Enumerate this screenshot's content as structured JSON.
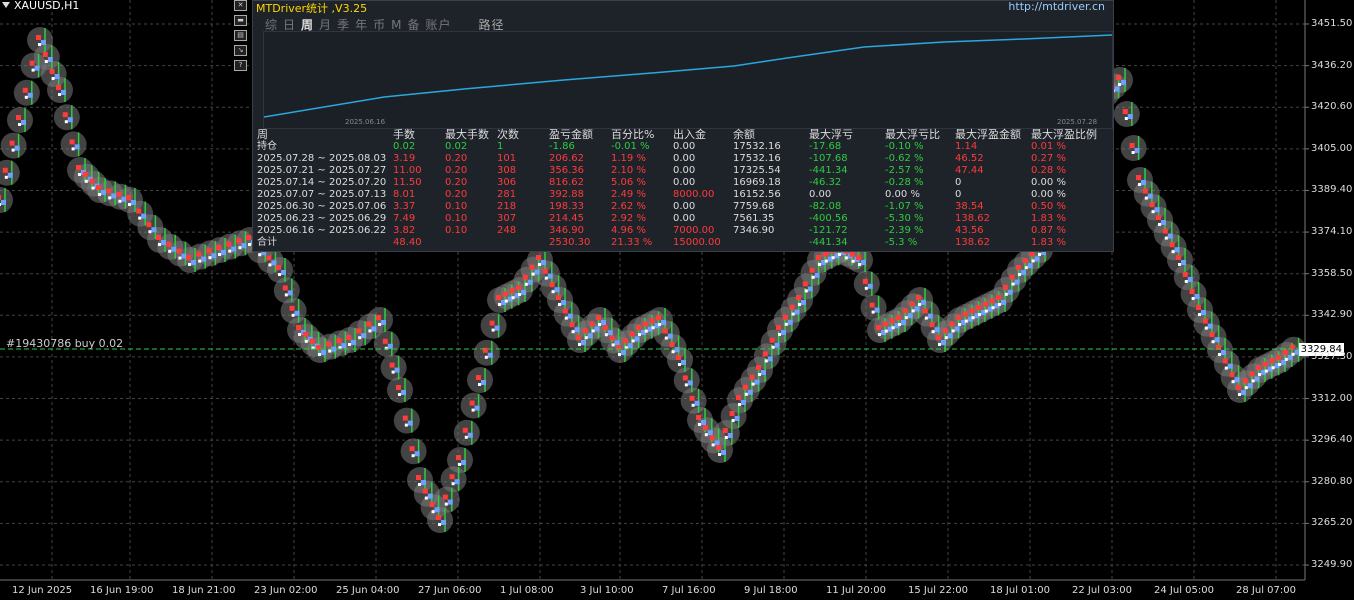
{
  "chart_header": {
    "symbol": "XAUUSD,H1"
  },
  "order_line": {
    "label": "#19430786 buy 0.02",
    "price": "3329.84"
  },
  "price_axis": [
    "3451.50",
    "3436.20",
    "3420.60",
    "3405.00",
    "3389.40",
    "3374.10",
    "3358.50",
    "3342.90",
    "3327.30",
    "3312.00",
    "3296.40",
    "3280.80",
    "3265.20",
    "3249.90"
  ],
  "time_axis": [
    "12 Jun 2025",
    "16 Jun 19:00",
    "18 Jun 21:00",
    "23 Jun 02:00",
    "25 Jun 04:00",
    "27 Jun 06:00",
    "1 Jul 08:00",
    "3 Jul 10:00",
    "7 Jul 16:00",
    "9 Jul 18:00",
    "11 Jul 20:00",
    "15 Jul 22:00",
    "18 Jul 01:00",
    "22 Jul 03:00",
    "24 Jul 05:00",
    "28 Jul 07:00"
  ],
  "side_icons": [
    "close-icon",
    "minimize-icon",
    "chart-icon",
    "arrow-icon",
    "help-icon"
  ],
  "colors": {
    "equity_line": "#2aa7e0",
    "profit": "#2ecc40",
    "loss": "#ff3b3b",
    "candle_up": "#2ecc40",
    "background": "#000000"
  },
  "panel": {
    "title": "MTDriver统计 ,V3.25",
    "link": "http://mtdriver.cn",
    "tabs": [
      "综",
      "日",
      "周",
      "月",
      "季",
      "年",
      "币",
      "M",
      "备",
      "账户"
    ],
    "active_tab": "周",
    "path_tab": "路径",
    "date_start": "2025.06.16",
    "date_end": "2025.07.28",
    "headers": [
      "周",
      "手数",
      "最大手数",
      "次数",
      "盈亏金额",
      "百分比%",
      "出入金",
      "余额",
      "最大浮亏",
      "最大浮亏比",
      "最大浮盈金额",
      "最大浮盈比例"
    ],
    "rows": [
      {
        "c": [
          "持仓",
          "0.02",
          "0.02",
          "1",
          "-1.86",
          "-0.01 %",
          "0.00",
          "17532.16",
          "-17.68",
          "-0.10 %",
          "1.14",
          "0.01 %"
        ],
        "k": [
          "w",
          "g",
          "g",
          "g",
          "g",
          "g",
          "w",
          "w",
          "g",
          "g",
          "r",
          "r"
        ]
      },
      {
        "c": [
          "2025.07.28 ~ 2025.08.03",
          "3.19",
          "0.20",
          "101",
          "206.62",
          "1.19 %",
          "0.00",
          "17532.16",
          "-107.68",
          "-0.62 %",
          "46.52",
          "0.27 %"
        ],
        "k": [
          "w",
          "r",
          "r",
          "r",
          "r",
          "r",
          "w",
          "w",
          "g",
          "g",
          "r",
          "r"
        ]
      },
      {
        "c": [
          "2025.07.21 ~ 2025.07.27",
          "11.00",
          "0.20",
          "308",
          "356.36",
          "2.10 %",
          "0.00",
          "17325.54",
          "-441.34",
          "-2.57 %",
          "47.44",
          "0.28 %"
        ],
        "k": [
          "w",
          "r",
          "r",
          "r",
          "r",
          "r",
          "w",
          "w",
          "g",
          "g",
          "r",
          "r"
        ]
      },
      {
        "c": [
          "2025.07.14 ~ 2025.07.20",
          "11.50",
          "0.20",
          "306",
          "816.62",
          "5.06 %",
          "0.00",
          "16969.18",
          "-46.32",
          "-0.28 %",
          "0",
          "0.00 %"
        ],
        "k": [
          "w",
          "r",
          "r",
          "r",
          "r",
          "r",
          "w",
          "w",
          "g",
          "g",
          "w",
          "w"
        ]
      },
      {
        "c": [
          "2025.07.07 ~ 2025.07.13",
          "8.01",
          "0.20",
          "281",
          "392.88",
          "2.49 %",
          "8000.00",
          "16152.56",
          "0.00",
          "0.00 %",
          "0",
          "0.00 %"
        ],
        "k": [
          "w",
          "r",
          "r",
          "r",
          "r",
          "r",
          "r",
          "w",
          "w",
          "w",
          "w",
          "w"
        ]
      },
      {
        "c": [
          "2025.06.30 ~ 2025.07.06",
          "3.37",
          "0.10",
          "218",
          "198.33",
          "2.62 %",
          "0.00",
          "7759.68",
          "-82.08",
          "-1.07 %",
          "38.54",
          "0.50 %"
        ],
        "k": [
          "w",
          "r",
          "r",
          "r",
          "r",
          "r",
          "w",
          "w",
          "g",
          "g",
          "r",
          "r"
        ]
      },
      {
        "c": [
          "2025.06.23 ~ 2025.06.29",
          "7.49",
          "0.10",
          "307",
          "214.45",
          "2.92 %",
          "0.00",
          "7561.35",
          "-400.56",
          "-5.30 %",
          "138.62",
          "1.83 %"
        ],
        "k": [
          "w",
          "r",
          "r",
          "r",
          "r",
          "r",
          "w",
          "w",
          "g",
          "g",
          "r",
          "r"
        ]
      },
      {
        "c": [
          "2025.06.16 ~ 2025.06.22",
          "3.82",
          "0.10",
          "248",
          "346.90",
          "4.96 %",
          "7000.00",
          "7346.90",
          "-121.72",
          "-2.39 %",
          "43.56",
          "0.87 %"
        ],
        "k": [
          "w",
          "r",
          "r",
          "r",
          "r",
          "r",
          "r",
          "w",
          "g",
          "g",
          "r",
          "r"
        ]
      },
      {
        "c": [
          "合计",
          "48.40",
          "",
          "",
          "2530.30",
          "21.33 %",
          "15000.00",
          "",
          "-441.34",
          "-5.3 %",
          "138.62",
          "1.83 %"
        ],
        "k": [
          "w",
          "r",
          "r",
          "r",
          "r",
          "r",
          "r",
          "w",
          "g",
          "g",
          "r",
          "r"
        ]
      }
    ]
  }
}
